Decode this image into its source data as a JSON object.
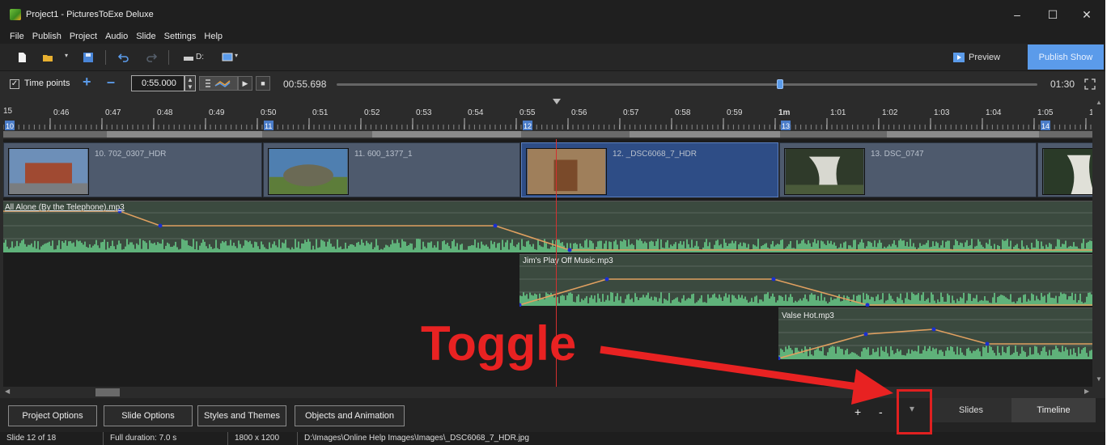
{
  "window": {
    "title": "Project1 - PicturesToExe Deluxe",
    "minimize": "–",
    "maximize": "☐",
    "close": "✕"
  },
  "menu": [
    "File",
    "Publish",
    "Project",
    "Audio",
    "Slide",
    "Settings",
    "Help"
  ],
  "toolbar": {
    "drive_label": "D:",
    "preview_label": "Preview",
    "publish_label": "Publish Show"
  },
  "timebar": {
    "time_points_label": "Time points",
    "time_points_checked": true,
    "current_time_input": "0:55.000",
    "position_readout": "00:55.698",
    "total_duration": "01:30",
    "slider_position": 0.6333
  },
  "ruler": {
    "ticks": [
      "0:46",
      "0:47",
      "0:48",
      "0:49",
      "0:50",
      "0:51",
      "0:52",
      "0:53",
      "0:54",
      "0:55",
      "0:56",
      "0:57",
      "0:58",
      "0:59",
      "1m",
      "1:01",
      "1:02",
      "1:03",
      "1:04",
      "1:05",
      "1:0"
    ],
    "slide_markers": [
      "10",
      "11",
      "12",
      "13",
      "14"
    ],
    "left_edge_label": "15"
  },
  "slides": [
    {
      "label": "10. 702_0307_HDR",
      "selected": false,
      "thumb_colors": [
        "#6d8fb8",
        "#a04a32",
        "#7a7d80"
      ]
    },
    {
      "label": "11. 600_1377_1",
      "selected": false,
      "thumb_colors": [
        "#4f7fb0",
        "#6b6a55",
        "#5d7d3a"
      ]
    },
    {
      "label": "12. _DSC6068_7_HDR",
      "selected": true,
      "thumb_colors": [
        "#3d6fa8",
        "#c9863a",
        "#7a4a2a"
      ]
    },
    {
      "label": "13. DSC_0747",
      "selected": false,
      "thumb_colors": [
        "#2f3a2a",
        "#d8d8d0",
        "#4a5a3a"
      ]
    },
    {
      "label": "",
      "selected": false,
      "thumb_colors": [
        "#2a3a28",
        "#e0e0d8",
        "#3a4a30"
      ]
    }
  ],
  "audio_tracks": [
    {
      "name": "All Alone (By the Telephone).mp3"
    },
    {
      "name": "Jim's Play Off Music.mp3"
    },
    {
      "name": "Valse Hot.mp3"
    }
  ],
  "bottom_buttons": [
    "Project Options",
    "Slide Options",
    "Styles and Themes",
    "Objects and Animation"
  ],
  "zoom": {
    "plus": "+",
    "minus": "-",
    "toggle": "▾"
  },
  "tabs": {
    "slides": "Slides",
    "timeline": "Timeline"
  },
  "status": [
    "Slide 12 of 18",
    "Full duration: 7.0 s",
    "1800 x 1200",
    "D:\\Images\\Online Help Images\\Images\\_DSC6068_7_HDR.jpg"
  ],
  "annotation": {
    "text": "Toggle",
    "color": "#e82222"
  }
}
